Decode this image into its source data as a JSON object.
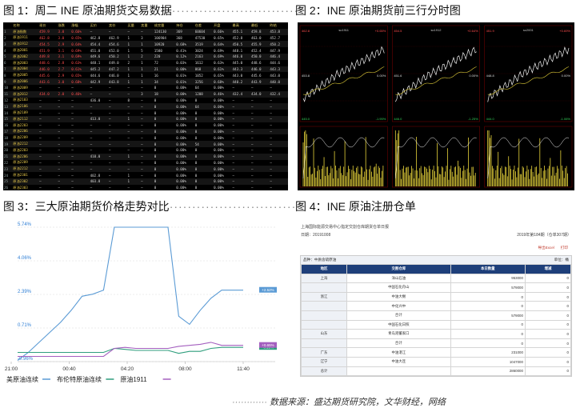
{
  "captions": {
    "fig1": "图 1：周二 INE 原油期货交易数据",
    "fig2": "图 2：INE 原油期货前三行分时图",
    "fig3": "图 3：三大原油期货价格走势对比",
    "fig4": "图 4：INE 原油注册仓单",
    "dots": "·····························"
  },
  "fig1": {
    "headers": [
      "",
      "名称",
      "现价",
      "涨跌",
      "涨幅",
      "买价",
      "卖价",
      "买量",
      "卖量",
      "成交量",
      "持仓",
      "仓差",
      "开盘",
      "最高",
      "最低",
      "昨结"
    ],
    "rows": [
      [
        "1",
        "原油指数",
        "459.9",
        "3.0",
        "0.66%",
        "—",
        "—",
        "—",
        "—",
        "124130",
        "369",
        "60604",
        "0.66%",
        "455.1",
        "459.8",
        "453.8"
      ],
      [
        "2",
        "原油1911",
        "462.8",
        "3.0",
        "0.65%",
        "462.8",
        "462.9",
        "1",
        "3",
        "106904",
        "368",
        "47530",
        "0.65%",
        "452.8",
        "463.0",
        "452.7"
      ],
      [
        "3",
        "原油1912",
        "454.5",
        "2.9",
        "0.64%",
        "454.4",
        "454.6",
        "1",
        "1",
        "10920",
        "0.68%",
        "3519",
        "0.64%",
        "450.5",
        "455.9",
        "450.2"
      ],
      [
        "4",
        "原油2001",
        "451.9",
        "3.1",
        "0.69%",
        "451.8",
        "452.0",
        "1",
        "5",
        "1580",
        "0.41%",
        "3024",
        "0.69%",
        "448.1",
        "452.4",
        "447.9"
      ],
      [
        "5",
        "原油2002",
        "449.8",
        "3.1",
        "0.69%",
        "449.6",
        "450.2",
        "1",
        "2",
        "220",
        "0.12%",
        "2163",
        "0.69%",
        "446.0",
        "450.0",
        "446.4"
      ],
      [
        "6",
        "原油2003",
        "448.6",
        "2.8",
        "0.63%",
        "448.1",
        "449.0",
        "2",
        "1",
        "72",
        "0.03%",
        "1612",
        "0.63%",
        "445.0",
        "448.6",
        "444.6"
      ],
      [
        "7",
        "原油2004",
        "446.0",
        "2.7",
        "0.61%",
        "445.2",
        "447.2",
        "1",
        "1",
        "21",
        "0.00%",
        "868",
        "0.61%",
        "443.3",
        "446.0",
        "443.3"
      ],
      [
        "8",
        "原油2005",
        "445.6",
        "2.9",
        "0.65%",
        "444.6",
        "446.0",
        "1",
        "1",
        "16",
        "0.01%",
        "1052",
        "0.65%",
        "443.0",
        "445.6",
        "443.0"
      ],
      [
        "9",
        "原油2006",
        "443.6",
        "3.0",
        "0.68%",
        "442.9",
        "443.8",
        "1",
        "1",
        "34",
        "0.01%",
        "3256",
        "0.68%",
        "440.2",
        "443.9",
        "440.0"
      ],
      [
        "10",
        "原油2009",
        "—",
        "—",
        "—",
        "—",
        "—",
        "—",
        "—",
        "0",
        "0.00%",
        "64",
        "0.00%",
        "—",
        "—",
        "—"
      ],
      [
        "11",
        "原油2012",
        "434.0",
        "2.0",
        "0.46%",
        "—",
        "—",
        "—",
        "3",
        "18",
        "0.00%",
        "1208",
        "0.46%",
        "432.4",
        "434.0",
        "432.4"
      ],
      [
        "12",
        "原油2103",
        "—",
        "—",
        "—",
        "436.0",
        "—",
        "8",
        "—",
        "0",
        "0.00%",
        "0",
        "0.00%",
        "—",
        "—",
        "—"
      ],
      [
        "13",
        "原油2106",
        "—",
        "—",
        "—",
        "—",
        "—",
        "—",
        "—",
        "0",
        "0.00%",
        "64",
        "0.00%",
        "—",
        "—",
        "—"
      ],
      [
        "14",
        "原油2109",
        "—",
        "—",
        "—",
        "—",
        "—",
        "—",
        "—",
        "0",
        "0.00%",
        "0",
        "0.00%",
        "—",
        "—",
        "—"
      ],
      [
        "15",
        "原油2112",
        "—",
        "—",
        "—",
        "413.0",
        "—",
        "1",
        "—",
        "0",
        "0.00%",
        "0",
        "0.00%",
        "—",
        "—",
        "—"
      ],
      [
        "16",
        "原油2203",
        "—",
        "—",
        "—",
        "—",
        "—",
        "—",
        "—",
        "0",
        "0.00%",
        "0",
        "0.00%",
        "—",
        "—",
        "—"
      ],
      [
        "17",
        "原油2206",
        "—",
        "—",
        "—",
        "—",
        "—",
        "—",
        "—",
        "0",
        "0.00%",
        "0",
        "0.00%",
        "—",
        "—",
        "—"
      ],
      [
        "18",
        "原油2209",
        "—",
        "—",
        "—",
        "—",
        "—",
        "—",
        "—",
        "0",
        "0.00%",
        "0",
        "0.00%",
        "—",
        "—",
        "—"
      ],
      [
        "19",
        "原油2212",
        "—",
        "—",
        "—",
        "—",
        "—",
        "—",
        "—",
        "0",
        "0.00%",
        "54",
        "0.00%",
        "—",
        "—",
        "—"
      ],
      [
        "20",
        "原油2203",
        "—",
        "—",
        "—",
        "—",
        "—",
        "—",
        "—",
        "0",
        "0.00%",
        "0",
        "0.00%",
        "—",
        "—",
        "—"
      ],
      [
        "21",
        "原油2206",
        "—",
        "—",
        "—",
        "410.0",
        "—",
        "1",
        "—",
        "0",
        "0.00%",
        "0",
        "0.00%",
        "—",
        "—",
        "—"
      ],
      [
        "22",
        "原油2209",
        "—",
        "—",
        "—",
        "—",
        "—",
        "—",
        "—",
        "0",
        "0.00%",
        "0",
        "0.00%",
        "—",
        "—",
        "—"
      ],
      [
        "23",
        "原油2212",
        "—",
        "—",
        "—",
        "—",
        "—",
        "—",
        "—",
        "0",
        "0.00%",
        "0",
        "0.00%",
        "—",
        "—",
        "—"
      ],
      [
        "24",
        "原油2301",
        "—",
        "—",
        "—",
        "402.8",
        "—",
        "1",
        "—",
        "0",
        "0.00%",
        "0",
        "0.00%",
        "—",
        "—",
        "—"
      ],
      [
        "25",
        "原油2302",
        "—",
        "—",
        "—",
        "403.8",
        "—",
        "1",
        "—",
        "0",
        "0.00%",
        "0",
        "0.00%",
        "—",
        "—",
        "—"
      ],
      [
        "26",
        "原油2303",
        "—",
        "—",
        "—",
        "—",
        "—",
        "—",
        "—",
        "0",
        "0.00%",
        "0",
        "0.00%",
        "—",
        "—",
        "—"
      ],
      [
        "27",
        "原油2304",
        "—",
        "—",
        "—",
        "404.1",
        "—",
        "1",
        "—",
        "0",
        "0.00%",
        "0",
        "0.00%",
        "—",
        "—",
        "—"
      ]
    ]
  },
  "fig2": {
    "panels": [
      {
        "title": "sc1911",
        "left_top": "462.8",
        "right_top": "+0.65%",
        "left_mid": "453.8",
        "right_mid": "0.00%",
        "left_bot": "445.0",
        "right_bot": "-1.95%"
      },
      {
        "title": "sc1912",
        "left_top": "454.5",
        "right_top": "+0.64%",
        "left_mid": "451.6",
        "right_mid": "0.00%",
        "left_bot": "446.0",
        "right_bot": "-1.25%"
      },
      {
        "title": "sc2001",
        "left_top": "451.9",
        "right_top": "+0.69%",
        "left_mid": "448.8",
        "right_mid": "0.00%",
        "left_bot": "444.0",
        "right_bot": "-1.06%"
      }
    ]
  },
  "chart_data": {
    "type": "line",
    "x_ticks": [
      "21:00",
      "00:40",
      "04:20",
      "08:00",
      "11:40"
    ],
    "y_ticks": [
      "5.74%",
      "4.06%",
      "2.39%",
      "0.71%",
      "-0.96%"
    ],
    "ylim": [
      -0.96,
      5.74
    ],
    "series": [
      {
        "name": "美原油连续",
        "color": "#5b9bd5",
        "values": [
          -0.9,
          -0.5,
          0.0,
          0.5,
          1.0,
          1.6,
          2.3,
          2.4,
          2.6,
          5.74,
          5.74,
          5.74,
          5.74,
          5.74,
          5.74,
          1.3,
          0.9,
          1.6,
          2.2,
          2.6,
          2.6,
          2.6
        ]
      },
      {
        "name": "布伦特原油连续",
        "color": "#2f9e7d",
        "values": [
          -0.5,
          -0.5,
          -0.5,
          -0.5,
          -0.5,
          -0.5,
          -0.5,
          -0.5,
          -0.5,
          -0.3,
          -0.35,
          -0.4,
          -0.4,
          -0.4,
          -0.4,
          -0.55,
          -0.45,
          -0.45,
          -0.3,
          -0.25,
          -0.25,
          -0.25
        ]
      },
      {
        "name": "原油1911",
        "color": "#a45fbf",
        "values": [
          -0.7,
          -0.7,
          -0.7,
          -0.7,
          -0.7,
          -0.7,
          -0.7,
          -0.7,
          -0.7,
          -0.3,
          -0.25,
          -0.3,
          -0.3,
          -0.3,
          -0.3,
          -0.2,
          -0.15,
          -0.1,
          0.0,
          -0.15,
          -0.15,
          -0.15
        ]
      }
    ],
    "series_tags": [
      "+2.52%",
      "-0.13%",
      "+0.65%"
    ]
  },
  "fig4": {
    "title": "上海国际能源交易中心指定交割仓库期货仓单日报",
    "date": "日期：20191008",
    "unit_note": "2019年第184期（仓单307期）",
    "buttons": [
      "导出Excel",
      "打印"
    ],
    "variety": "品种：中质含硫原油",
    "unit": "单位：桶",
    "headers": [
      "地区",
      "交割仓库",
      "本日数量",
      "增减"
    ],
    "rows": [
      [
        "上海",
        "洋山石油",
        "953000",
        "0"
      ],
      [
        "",
        "中国石化舟山",
        "579000",
        "0"
      ],
      [
        "浙江",
        "中油大榭",
        "0",
        "0"
      ],
      [
        "",
        "中化兴中",
        "0",
        "0"
      ],
      [
        "",
        "合计",
        "579000",
        "0"
      ],
      [
        "",
        "中国石化日照",
        "0",
        "0"
      ],
      [
        "山东",
        "青岛港董家口",
        "0",
        "0"
      ],
      [
        "",
        "合计",
        "0",
        "0"
      ],
      [
        "广东",
        "中油湛江",
        "231000",
        "0"
      ],
      [
        "辽宁",
        "中油大连",
        "1047000",
        "0"
      ],
      [
        "总计",
        "",
        "2860000",
        "0"
      ]
    ]
  },
  "footer": "数据来源：盛达期货研究院，文华财经，网络"
}
